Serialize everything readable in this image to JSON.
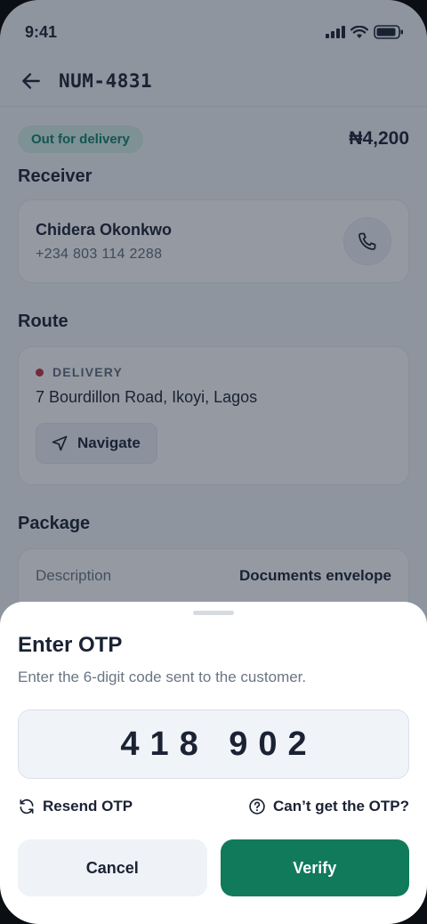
{
  "status_bar": {
    "time": "9:41",
    "icons": [
      "signal-icon",
      "wifi-icon",
      "battery-icon"
    ]
  },
  "app_bar": {
    "back_icon": "arrow-left-icon",
    "order_id": "NUM-4831"
  },
  "order": {
    "status": "Out for delivery",
    "price": "₦4,200"
  },
  "receiver": {
    "section_title": "Receiver",
    "name": "Chidera Okonkwo",
    "phone": "+234 803 114 2288",
    "call_icon": "phone-icon"
  },
  "route": {
    "section_title": "Route",
    "label": "DELIVERY",
    "address": "7 Bourdillon Road, Ikoyi, Lagos",
    "navigate_label": "Navigate",
    "navigate_icon": "navigation-arrow-icon"
  },
  "package": {
    "section_title": "Package",
    "description_key": "Description",
    "description_value": "Documents envelope"
  },
  "otp_sheet": {
    "title": "Enter OTP",
    "subtitle": "Enter the 6-digit code sent to the customer.",
    "otp_value": "418 902",
    "resend_label": "Resend OTP",
    "help_label": "Can’t get the OTP?",
    "cancel_label": "Cancel",
    "verify_label": "Verify"
  },
  "colors": {
    "accent": "#117a5a",
    "badge_bg": "#d4efe7",
    "badge_text": "#12806a",
    "delivery_dot": "#c0353f",
    "overlay": "rgba(24,34,52,0.46)"
  }
}
